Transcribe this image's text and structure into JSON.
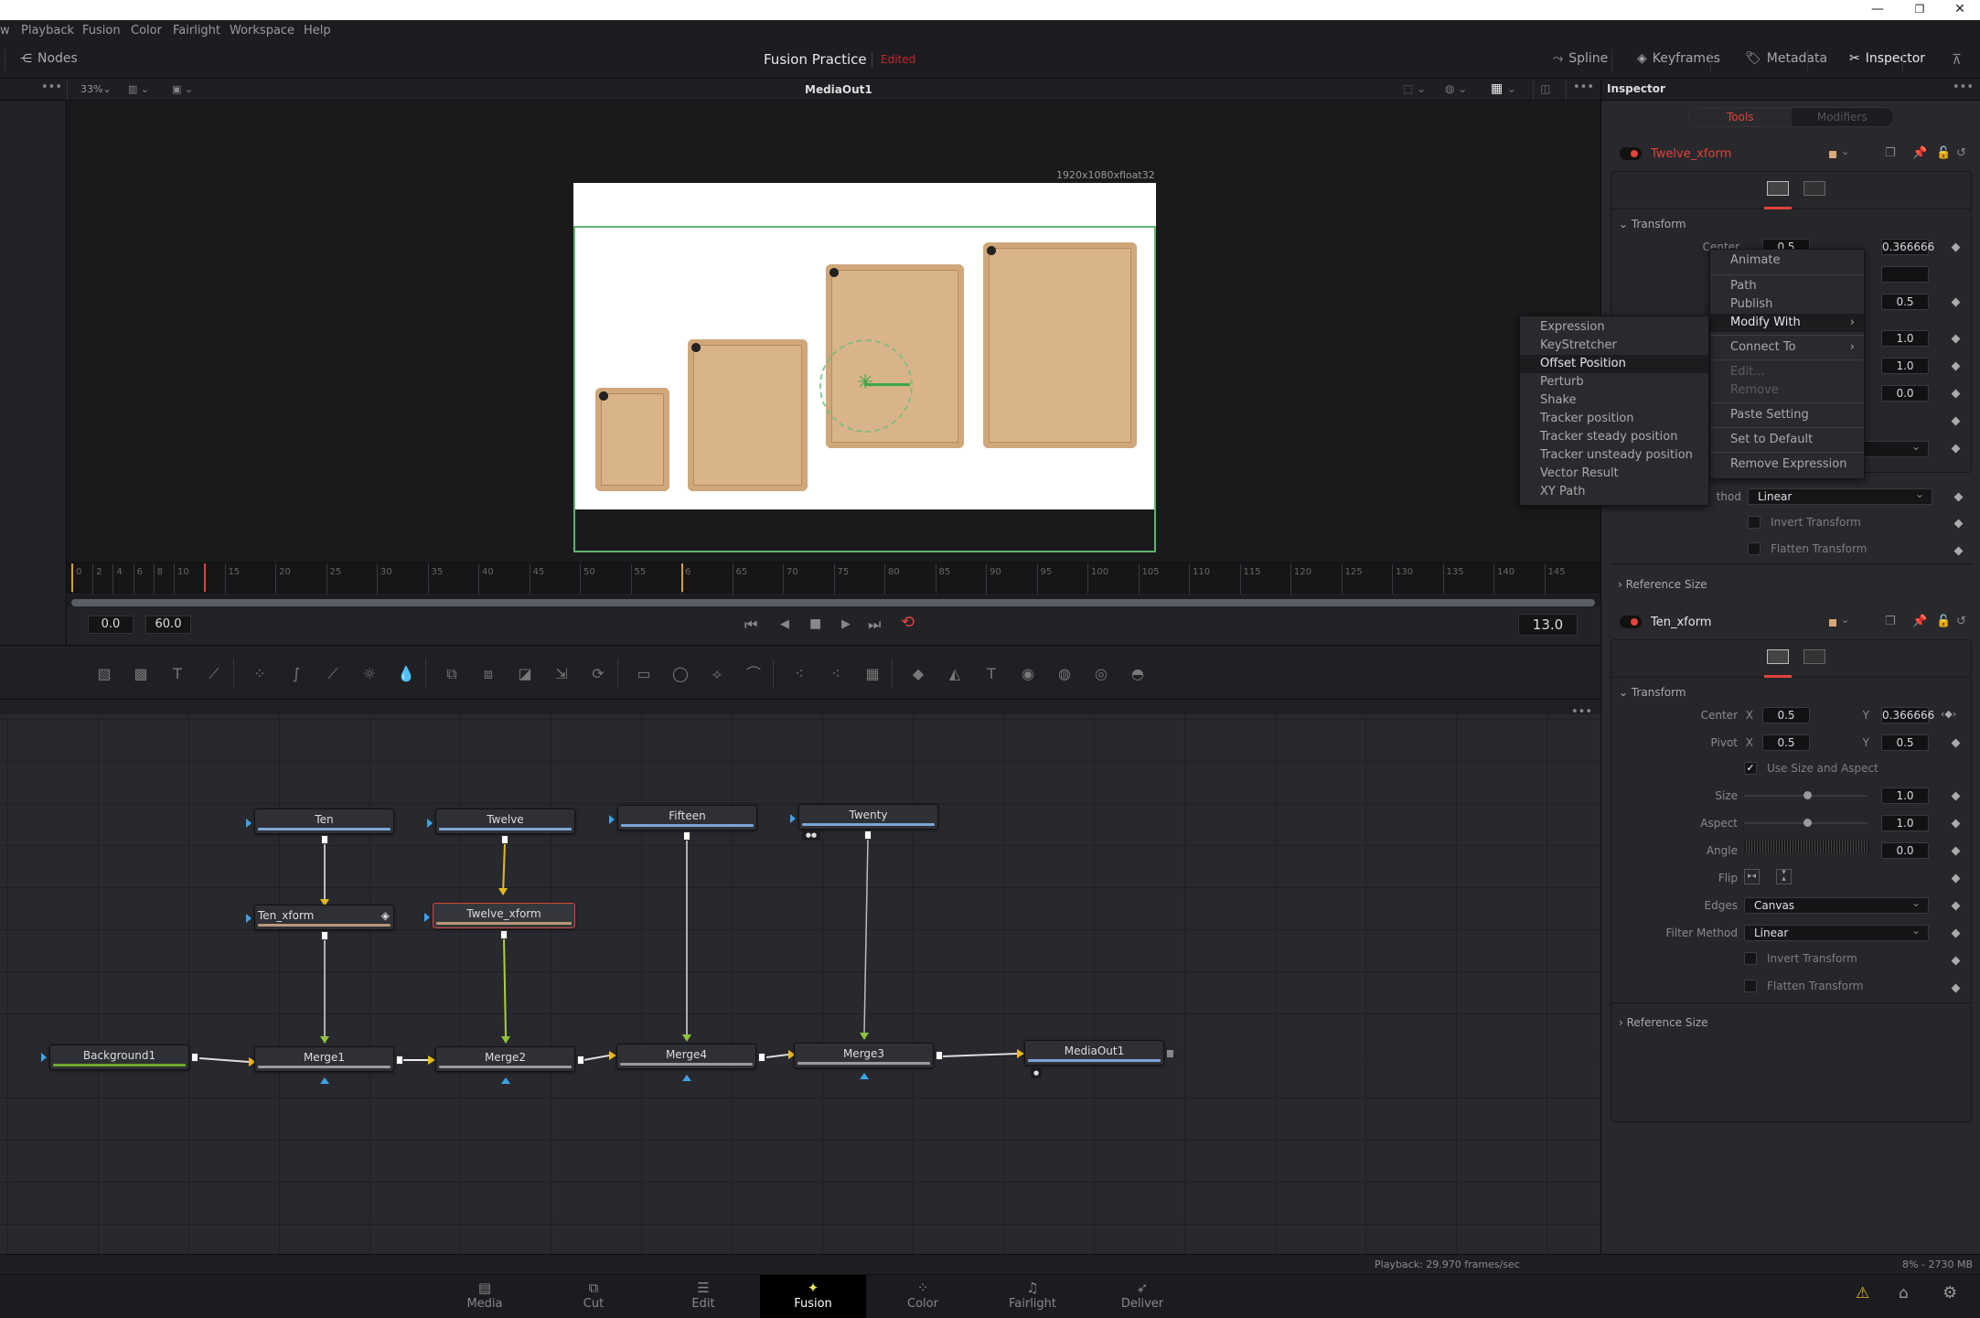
{
  "window": {
    "minimize": "—",
    "restore": "❐",
    "close": "✕"
  },
  "menubar": [
    "w",
    "Playback",
    "Fusion",
    "Color",
    "Fairlight",
    "Workspace",
    "Help"
  ],
  "toolbar": {
    "nodes_label": "Nodes",
    "project_title": "Fusion Practice",
    "project_status": "Edited",
    "right_buttons": [
      {
        "label": "Spline",
        "icon": "spline-icon"
      },
      {
        "label": "Keyframes",
        "icon": "keyframes-icon"
      },
      {
        "label": "Metadata",
        "icon": "metadata-icon"
      },
      {
        "label": "Inspector",
        "icon": "inspector-icon"
      }
    ]
  },
  "viewer": {
    "zoom": "33%",
    "title": "MediaOut1",
    "resolution": "1920x1080xfloat32",
    "overlay_color": "#5fb36b"
  },
  "timeline": {
    "ticks": [
      "0",
      "2",
      "4",
      "6",
      "8",
      "10",
      "15",
      "20",
      "25",
      "30",
      "35",
      "40",
      "45",
      "50",
      "55",
      "6",
      "65",
      "70",
      "75",
      "80",
      "85",
      "90",
      "95",
      "100",
      "105",
      "110",
      "115",
      "120",
      "125",
      "130",
      "135",
      "140",
      "145"
    ],
    "start": "0.0",
    "end": "60.0",
    "current": "13.0",
    "playhead_frame": 13,
    "render_end_frame": 60
  },
  "transport": {
    "first": "⏮",
    "prev": "◀",
    "stop": "■",
    "play": "▶",
    "last": "⏭",
    "loop": "⟲"
  },
  "tools": [
    "background-icon",
    "fast-noise-icon",
    "text-icon",
    "paint-icon",
    "color-corrector-icon",
    "color-curves-icon",
    "hue-curves-icon",
    "brightness-contrast-icon",
    "blur-icon",
    "merge-icon",
    "channel-booleans-icon",
    "matte-control-icon",
    "resize-icon",
    "transform-icon",
    "rectangle-mask-icon",
    "ellipse-mask-icon",
    "polygon-mask-icon",
    "bspline-mask-icon",
    "pemitter-icon",
    "prender-icon",
    "pimage-icon",
    "shape3d-icon",
    "merge3d-icon",
    "text3d-icon",
    "camera3d-icon",
    "renderer3d-icon",
    "spotlight-icon",
    "imageplane3d-icon"
  ],
  "nodes": [
    {
      "id": "ten",
      "label": "Ten",
      "bar": "#7aa6d6"
    },
    {
      "id": "twelve",
      "label": "Twelve",
      "bar": "#7aa6d6"
    },
    {
      "id": "fifteen",
      "label": "Fifteen",
      "bar": "#7aa6d6"
    },
    {
      "id": "twenty",
      "label": "Twenty",
      "bar": "#7aa6d6"
    },
    {
      "id": "ten_xform",
      "label": "Ten_xform",
      "bar": "#b8977a"
    },
    {
      "id": "twelve_xform",
      "label": "Twelve_xform",
      "bar": "#b8977a",
      "selected": true
    },
    {
      "id": "background1",
      "label": "Background1",
      "bar": "#6ea832"
    },
    {
      "id": "merge1",
      "label": "Merge1",
      "bar": "#9a9a9e"
    },
    {
      "id": "merge2",
      "label": "Merge2",
      "bar": "#9a9a9e"
    },
    {
      "id": "merge4",
      "label": "Merge4",
      "bar": "#9a9a9e"
    },
    {
      "id": "merge3",
      "label": "Merge3",
      "bar": "#9a9a9e"
    },
    {
      "id": "mediaout1",
      "label": "MediaOut1",
      "bar": "#7aa6d6"
    }
  ],
  "status": {
    "playback": "Playback: 29.970 frames/sec",
    "memory": "8% - 2730 MB"
  },
  "pages": [
    {
      "label": "Media",
      "icon": "▤"
    },
    {
      "label": "Cut",
      "icon": "⧉"
    },
    {
      "label": "Edit",
      "icon": "☰"
    },
    {
      "label": "Fusion",
      "icon": "✦",
      "active": true
    },
    {
      "label": "Color",
      "icon": "⁘"
    },
    {
      "label": "Fairlight",
      "icon": "♫"
    },
    {
      "label": "Deliver",
      "icon": "➶"
    }
  ],
  "inspector": {
    "title": "Inspector",
    "tabs": {
      "tools": "Tools",
      "modifiers": "Modifiers"
    },
    "node1": {
      "name": "Twelve_xform",
      "name_color": "#e0443a",
      "swatch": "#d8a878",
      "section": "Transform",
      "center_label": "Center",
      "center_x": "0.5",
      "center_y": "0.366666",
      "pivot_y": "0.5",
      "size": "1.0",
      "aspect": "1.0",
      "angle": "0.0",
      "filter_method_partial": "thod",
      "filter_method": "Linear",
      "invert": "Invert Transform",
      "flatten": "Flatten Transform",
      "reference": "Reference Size"
    },
    "node2": {
      "name": "Ten_xform",
      "swatch": "#d8a878",
      "section": "Transform",
      "center_label": "Center",
      "center_x": "0.5",
      "center_y": "0.366666",
      "pivot_label": "Pivot",
      "pivot_x": "0.5",
      "pivot_y": "0.5",
      "use_size": "Use Size and Aspect",
      "use_size_checked": true,
      "size_label": "Size",
      "size": "1.0",
      "aspect_label": "Aspect",
      "aspect": "1.0",
      "angle_label": "Angle",
      "angle": "0.0",
      "flip_label": "Flip",
      "edges_label": "Edges",
      "edges": "Canvas",
      "filter_label": "Filter Method",
      "filter_method": "Linear",
      "invert": "Invert Transform",
      "flatten": "Flatten Transform",
      "reference": "Reference Size",
      "x": "X",
      "y": "Y"
    }
  },
  "context_menu": {
    "items": [
      "Animate",
      "Path",
      "Publish",
      "Modify With",
      "Connect To",
      "Edit...",
      "Remove",
      "Paste Setting",
      "Set to Default",
      "Remove Expression"
    ],
    "highlighted": "Modify With"
  },
  "submenu": {
    "items": [
      "Expression",
      "KeyStretcher",
      "Offset Position",
      "Perturb",
      "Shake",
      "Tracker position",
      "Tracker steady position",
      "Tracker unsteady position",
      "Vector Result",
      "XY Path"
    ],
    "highlighted": "Offset Position"
  }
}
